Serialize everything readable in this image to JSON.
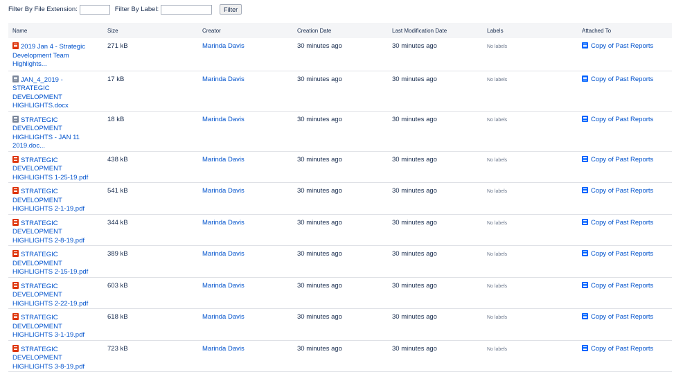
{
  "filters": {
    "extension_label": "Filter By File Extension:",
    "extension_value": "",
    "label_label": "Filter By Label:",
    "label_value": "",
    "button_label": "Filter"
  },
  "table": {
    "headers": [
      "Name",
      "Size",
      "Creator",
      "Creation Date",
      "Last Modification Date",
      "Labels",
      "Attached To"
    ],
    "rows": [
      {
        "type": "pdf",
        "name_lines": [
          "2019 Jan 4 - Strategic",
          "Development Team",
          "Highlights..."
        ],
        "size": "271 kB",
        "creator": "Marinda Davis",
        "created": "30 minutes ago",
        "modified": "30 minutes ago",
        "labels": "No labels",
        "attached_to": "Copy of Past Reports"
      },
      {
        "type": "doc",
        "name_lines": [
          "JAN_4_2019 - STRATEGIC",
          "DEVELOPMENT",
          "HIGHLIGHTS.docx"
        ],
        "size": "17 kB",
        "creator": "Marinda Davis",
        "created": "30 minutes ago",
        "modified": "30 minutes ago",
        "labels": "No labels",
        "attached_to": "Copy of Past Reports"
      },
      {
        "type": "doc",
        "name_lines": [
          "STRATEGIC DEVELOPMENT",
          "HIGHLIGHTS - JAN 11",
          "2019.doc..."
        ],
        "size": "18 kB",
        "creator": "Marinda Davis",
        "created": "30 minutes ago",
        "modified": "30 minutes ago",
        "labels": "No labels",
        "attached_to": "Copy of Past Reports"
      },
      {
        "type": "pdf",
        "name_lines": [
          "STRATEGIC DEVELOPMENT",
          "HIGHLIGHTS 1-25-19.pdf"
        ],
        "size": "438 kB",
        "creator": "Marinda Davis",
        "created": "30 minutes ago",
        "modified": "30 minutes ago",
        "labels": "No labels",
        "attached_to": "Copy of Past Reports"
      },
      {
        "type": "pdf",
        "name_lines": [
          "STRATEGIC DEVELOPMENT",
          "HIGHLIGHTS 2-1-19.pdf"
        ],
        "size": "541 kB",
        "creator": "Marinda Davis",
        "created": "30 minutes ago",
        "modified": "30 minutes ago",
        "labels": "No labels",
        "attached_to": "Copy of Past Reports"
      },
      {
        "type": "pdf",
        "name_lines": [
          "STRATEGIC DEVELOPMENT",
          "HIGHLIGHTS 2-8-19.pdf"
        ],
        "size": "344 kB",
        "creator": "Marinda Davis",
        "created": "30 minutes ago",
        "modified": "30 minutes ago",
        "labels": "No labels",
        "attached_to": "Copy of Past Reports"
      },
      {
        "type": "pdf",
        "name_lines": [
          "STRATEGIC DEVELOPMENT",
          "HIGHLIGHTS 2-15-19.pdf"
        ],
        "size": "389 kB",
        "creator": "Marinda Davis",
        "created": "30 minutes ago",
        "modified": "30 minutes ago",
        "labels": "No labels",
        "attached_to": "Copy of Past Reports"
      },
      {
        "type": "pdf",
        "name_lines": [
          "STRATEGIC DEVELOPMENT",
          "HIGHLIGHTS 2-22-19.pdf"
        ],
        "size": "603 kB",
        "creator": "Marinda Davis",
        "created": "30 minutes ago",
        "modified": "30 minutes ago",
        "labels": "No labels",
        "attached_to": "Copy of Past Reports"
      },
      {
        "type": "pdf",
        "name_lines": [
          "STRATEGIC DEVELOPMENT",
          "HIGHLIGHTS 3-1-19.pdf"
        ],
        "size": "618 kB",
        "creator": "Marinda Davis",
        "created": "30 minutes ago",
        "modified": "30 minutes ago",
        "labels": "No labels",
        "attached_to": "Copy of Past Reports"
      },
      {
        "type": "pdf",
        "name_lines": [
          "STRATEGIC DEVELOPMENT",
          "HIGHLIGHTS 3-8-19.pdf"
        ],
        "size": "723 kB",
        "creator": "Marinda Davis",
        "created": "30 minutes ago",
        "modified": "30 minutes ago",
        "labels": "No labels",
        "attached_to": "Copy of Past Reports"
      }
    ]
  },
  "icons": {
    "pdf": "pdf-file-icon",
    "doc": "word-document-icon",
    "attached": "confluence-page-icon"
  },
  "colors": {
    "link": "#0052cc",
    "pdf_icon": "#de350b",
    "doc_icon": "#7a869a",
    "page_icon": "#0065ff",
    "header_bg": "#f4f5f7"
  }
}
